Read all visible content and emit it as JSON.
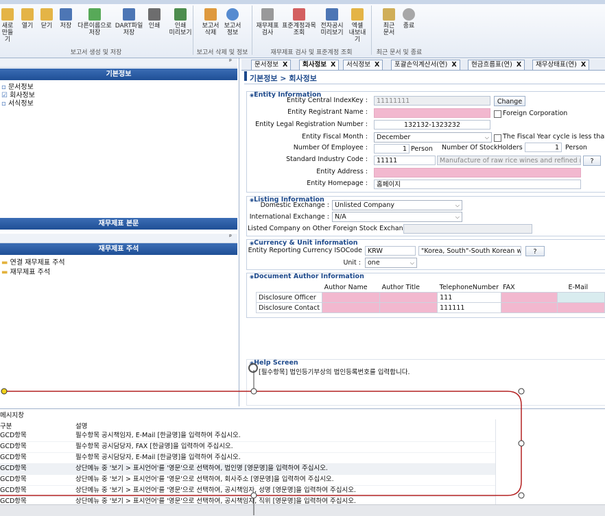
{
  "ribbon": {
    "buttons": [
      {
        "label": "새로\n만들기",
        "icon": "new-icon"
      },
      {
        "label": "열기",
        "icon": "open-folder-icon"
      },
      {
        "label": "닫기",
        "icon": "close-folder-icon"
      },
      {
        "label": "저장",
        "icon": "save-icon"
      },
      {
        "label": "다른이름으로\n저장",
        "icon": "save-as-icon"
      },
      {
        "label": "DART파일\n저장",
        "icon": "dart-save-icon"
      },
      {
        "label": "인쇄",
        "icon": "print-icon"
      },
      {
        "label": "인쇄\n미리보기",
        "icon": "print-preview-icon"
      },
      {
        "label": "보고서\n삭제",
        "icon": "report-delete-icon"
      },
      {
        "label": "보고서\n정보",
        "icon": "report-info-icon"
      },
      {
        "label": "재무제표\n검사",
        "icon": "xbrl-check-icon"
      },
      {
        "label": "표준계정과목\n조회",
        "icon": "account-search-icon"
      },
      {
        "label": "전자공시\n미리보기",
        "icon": "disclosure-preview-icon"
      },
      {
        "label": "엑셀\n내보내기",
        "icon": "excel-export-icon"
      },
      {
        "label": "최근\n문서",
        "icon": "recent-docs-icon"
      },
      {
        "label": "종료",
        "icon": "exit-icon"
      }
    ],
    "groups": [
      "보고서 생성 및 저장",
      "보고서 삭제 및 정보",
      "재무제표 검사 및 표준계정 조회",
      "최근 문서 및 종료"
    ]
  },
  "left": {
    "basic_header": "기본정보",
    "tree": [
      "문서정보",
      "회사정보",
      "서식정보"
    ],
    "fs_body_header": "재무제표 본문",
    "notes_header": "재무제표 주석",
    "notes_tree": [
      "연결 재무제표 주석",
      "재무제표 주석"
    ],
    "pin": "ᵖ"
  },
  "tabs": [
    {
      "label": "문서정보",
      "active": false
    },
    {
      "label": "회사정보",
      "active": true
    },
    {
      "label": "서식정보",
      "active": false
    },
    {
      "label": "포괄손익계산서(연)",
      "active": false
    },
    {
      "label": "현금흐름표(연)",
      "active": false
    },
    {
      "label": "재무상태표(연)",
      "active": false
    }
  ],
  "tab_close": "X",
  "breadcrumb": "기본정보 > 회사정보",
  "entity": {
    "title": "Entity Information",
    "central_key_label": "Entity Central IndexKey :",
    "central_key_value": "11111111",
    "change_btn": "Change",
    "registrant_label": "Entity Registrant Name :",
    "registrant_value": "",
    "foreign_label": "Foreign Corporation",
    "legal_reg_label": "Entity Legal Registration Number :",
    "legal_reg_value": "132132-1323232",
    "fiscal_month_label": "Entity Fiscal Month :",
    "fiscal_month_value": "December",
    "fiscal_cycle_label": "The Fiscal Year cycle is less than",
    "employee_label": "Number Of Employee :",
    "employee_value": "1",
    "person1": "Person",
    "stockholders_label": "Number Of StockHolders :",
    "stockholders_value": "1",
    "person2": "Person",
    "industry_label": "Standard Industry Code :",
    "industry_code": "11111",
    "industry_desc": "Manufacture of raw rice wines and refined rice",
    "help_btn": "?",
    "address_label": "Entity Address :",
    "address_value": "",
    "homepage_label": "Entity Homepage :",
    "homepage_value": "홈페이지"
  },
  "listing": {
    "title": "Listing Information",
    "domestic_label": "Domestic Exchange :",
    "domestic_value": "Unlisted Company",
    "international_label": "International Exchange :",
    "international_value": "N/A",
    "other_label": "Listed Company on Other Foreign Stock Exchange :",
    "other_value": ""
  },
  "currency": {
    "title": "Currency & Unit information",
    "iso_label": "Entity Reporting Currency ISOCode",
    "iso_value": "KRW",
    "country_value": "\"Korea, South\"-South Korean won",
    "help_btn": "?",
    "unit_label": "Unit :",
    "unit_value": "one"
  },
  "author": {
    "title": "Document Author Information",
    "columns": [
      "Author Name",
      "Author Title",
      "TelephoneNumber",
      "FAX",
      "E-Mail"
    ],
    "rows": [
      {
        "label": "Disclosure Officer",
        "phone": "111"
      },
      {
        "label": "Disclosure Contact",
        "phone": "111111"
      }
    ]
  },
  "help": {
    "title": "Help Screen",
    "text": "[필수항목] 법인등기부상의 법인등록번호를 입력합니다."
  },
  "messages": {
    "title": "메시지창",
    "col1": "구분",
    "col2": "설명",
    "rows": [
      {
        "type": "GCD항목",
        "desc": "필수항목 공시책임자, E-Mail [한글명]을 입력하여 주십시오."
      },
      {
        "type": "GCD항목",
        "desc": "필수항목 공시담당자, FAX [한글명]을 입력하여 주십시오."
      },
      {
        "type": "GCD항목",
        "desc": "필수항목 공시담당자, E-Mail [한글명]을 입력하여 주십시오."
      },
      {
        "type": "GCD항목",
        "desc": "상단메뉴 중 '보기 > 표시언어'를 '영문'으로 선택하여, 법인명 [영문명]을 입력하여 주십시오."
      },
      {
        "type": "GCD항목",
        "desc": "상단메뉴 중 '보기 > 표시언어'를 '영문'으로 선택하여, 회사주소 [영문명]을 입력하여 주십시오."
      },
      {
        "type": "GCD항목",
        "desc": "상단메뉴 중 '보기 > 표시언어'를 '영문'으로 선택하여, 공시책임자, 성명 [영문명]을 입력하여 주십시오."
      },
      {
        "type": "GCD항목",
        "desc": "상단메뉴 중 '보기 > 표시언어'를 '영문'으로 선택하여, 공시책임자, 직위 [영문명]을 입력하여 주십시오."
      }
    ]
  },
  "colors": {
    "accent": "#1e4a8c",
    "pink": "#f2b8cf",
    "header_blue": "#2c5ea8",
    "red_line": "#b42020"
  }
}
